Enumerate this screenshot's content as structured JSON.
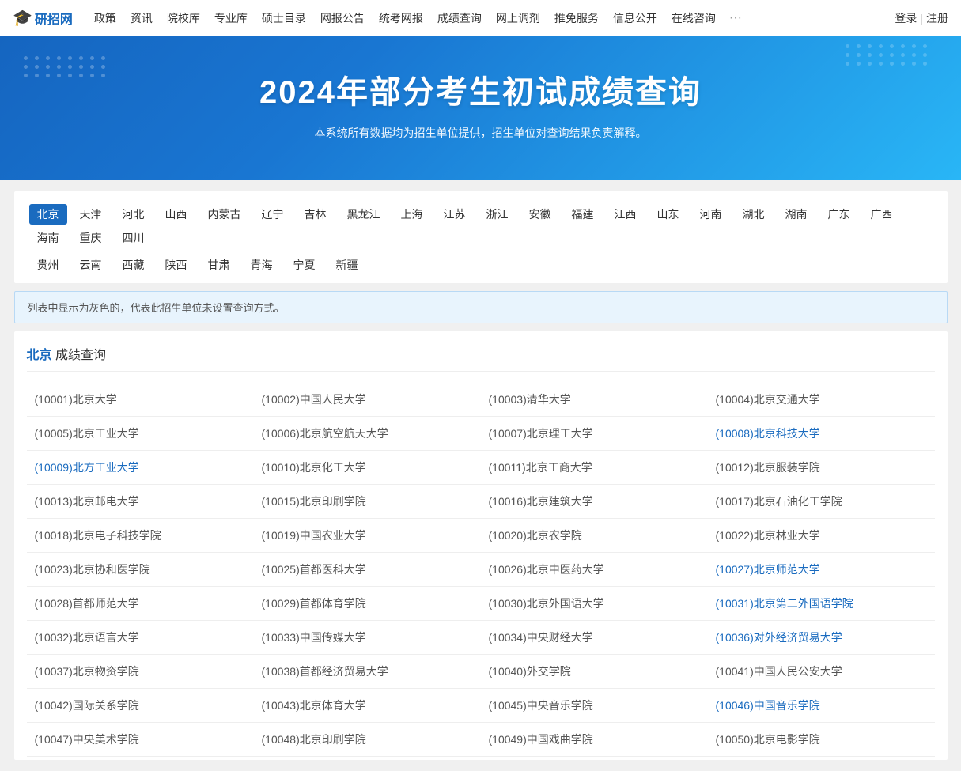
{
  "nav": {
    "logo_text": "研招网",
    "items": [
      {
        "label": "政策",
        "id": "nav-policy"
      },
      {
        "label": "资讯",
        "id": "nav-news"
      },
      {
        "label": "院校库",
        "id": "nav-schools"
      },
      {
        "label": "专业库",
        "id": "nav-majors"
      },
      {
        "label": "硕士目录",
        "id": "nav-catalog"
      },
      {
        "label": "网报公告",
        "id": "nav-announce"
      },
      {
        "label": "统考网报",
        "id": "nav-enroll"
      },
      {
        "label": "成绩查询",
        "id": "nav-scores"
      },
      {
        "label": "网上调剂",
        "id": "nav-adjust"
      },
      {
        "label": "推免服务",
        "id": "nav-exempt"
      },
      {
        "label": "信息公开",
        "id": "nav-info"
      },
      {
        "label": "在线咨询",
        "id": "nav-consult"
      }
    ],
    "more": "···",
    "login": "登录",
    "sep": "|",
    "register": "注册"
  },
  "hero": {
    "title": "2024年部分考生初试成绩查询",
    "subtitle": "本系统所有数据均为招生单位提供，招生单位对查询结果负责解释。"
  },
  "regions": {
    "row1": [
      {
        "label": "北京",
        "active": true
      },
      {
        "label": "天津"
      },
      {
        "label": "河北"
      },
      {
        "label": "山西"
      },
      {
        "label": "内蒙古"
      },
      {
        "label": "辽宁"
      },
      {
        "label": "吉林"
      },
      {
        "label": "黑龙江"
      },
      {
        "label": "上海"
      },
      {
        "label": "江苏"
      },
      {
        "label": "浙江"
      },
      {
        "label": "安徽"
      },
      {
        "label": "福建"
      },
      {
        "label": "江西"
      },
      {
        "label": "山东"
      },
      {
        "label": "河南"
      },
      {
        "label": "湖北"
      },
      {
        "label": "湖南"
      },
      {
        "label": "广东"
      },
      {
        "label": "广西"
      },
      {
        "label": "海南"
      },
      {
        "label": "重庆"
      },
      {
        "label": "四川"
      }
    ],
    "row2": [
      {
        "label": "贵州"
      },
      {
        "label": "云南"
      },
      {
        "label": "西藏"
      },
      {
        "label": "陕西"
      },
      {
        "label": "甘肃"
      },
      {
        "label": "青海"
      },
      {
        "label": "宁夏"
      },
      {
        "label": "新疆"
      }
    ]
  },
  "info_box": "列表中显示为灰色的，代表此招生单位未设置查询方式。",
  "section": {
    "region_name": "北京",
    "title_suffix": "成绩查询"
  },
  "universities": [
    [
      {
        "code": "10001",
        "name": "北京大学",
        "link": false
      },
      {
        "code": "10002",
        "name": "中国人民大学",
        "link": false
      },
      {
        "code": "10003",
        "name": "清华大学",
        "link": false
      },
      {
        "code": "10004",
        "name": "北京交通大学",
        "link": false
      }
    ],
    [
      {
        "code": "10005",
        "name": "北京工业大学",
        "link": false
      },
      {
        "code": "10006",
        "name": "北京航空航天大学",
        "link": false
      },
      {
        "code": "10007",
        "name": "北京理工大学",
        "link": false
      },
      {
        "code": "10008",
        "name": "北京科技大学",
        "link": true
      }
    ],
    [
      {
        "code": "10009",
        "name": "北方工业大学",
        "link": true
      },
      {
        "code": "10010",
        "name": "北京化工大学",
        "link": false
      },
      {
        "code": "10011",
        "name": "北京工商大学",
        "link": false
      },
      {
        "code": "10012",
        "name": "北京服装学院",
        "link": false
      }
    ],
    [
      {
        "code": "10013",
        "name": "北京邮电大学",
        "link": false
      },
      {
        "code": "10015",
        "name": "北京印刷学院",
        "link": false
      },
      {
        "code": "10016",
        "name": "北京建筑大学",
        "link": false
      },
      {
        "code": "10017",
        "name": "北京石油化工学院",
        "link": false
      }
    ],
    [
      {
        "code": "10018",
        "name": "北京电子科技学院",
        "link": false
      },
      {
        "code": "10019",
        "name": "中国农业大学",
        "link": false
      },
      {
        "code": "10020",
        "name": "北京农学院",
        "link": false
      },
      {
        "code": "10022",
        "name": "北京林业大学",
        "link": false
      }
    ],
    [
      {
        "code": "10023",
        "name": "北京协和医学院",
        "link": false
      },
      {
        "code": "10025",
        "name": "首都医科大学",
        "link": false
      },
      {
        "code": "10026",
        "name": "北京中医药大学",
        "link": false
      },
      {
        "code": "10027",
        "name": "北京师范大学",
        "link": true
      }
    ],
    [
      {
        "code": "10028",
        "name": "首都师范大学",
        "link": false
      },
      {
        "code": "10029",
        "name": "首都体育学院",
        "link": false
      },
      {
        "code": "10030",
        "name": "北京外国语大学",
        "link": false
      },
      {
        "code": "10031",
        "name": "北京第二外国语学院",
        "link": true
      }
    ],
    [
      {
        "code": "10032",
        "name": "北京语言大学",
        "link": false
      },
      {
        "code": "10033",
        "name": "中国传媒大学",
        "link": false
      },
      {
        "code": "10034",
        "name": "中央财经大学",
        "link": false
      },
      {
        "code": "10036",
        "name": "对外经济贸易大学",
        "link": true
      }
    ],
    [
      {
        "code": "10037",
        "name": "北京物资学院",
        "link": false
      },
      {
        "code": "10038",
        "name": "首都经济贸易大学",
        "link": false
      },
      {
        "code": "10040",
        "name": "外交学院",
        "link": false
      },
      {
        "code": "10041",
        "name": "中国人民公安大学",
        "link": false
      }
    ],
    [
      {
        "code": "10042",
        "name": "国际关系学院",
        "link": false
      },
      {
        "code": "10043",
        "name": "北京体育大学",
        "link": false
      },
      {
        "code": "10045",
        "name": "中央音乐学院",
        "link": false
      },
      {
        "code": "10046",
        "name": "中国音乐学院",
        "link": true
      }
    ],
    [
      {
        "code": "10047",
        "name": "中央美术学院",
        "link": false
      },
      {
        "code": "10048",
        "name": "北京印刷学院",
        "link": false
      },
      {
        "code": "10049",
        "name": "中国戏曲学院",
        "link": false
      },
      {
        "code": "10050",
        "name": "北京电影学院",
        "link": false
      }
    ]
  ]
}
